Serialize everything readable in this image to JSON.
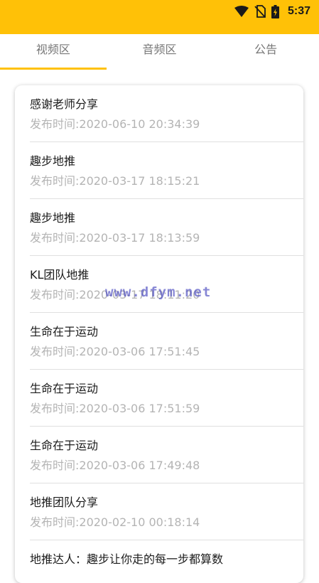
{
  "status_bar": {
    "time": "5:37",
    "background_color": "#ffc107",
    "icons": [
      "wifi-icon",
      "no-sim-icon",
      "battery-charging-icon"
    ]
  },
  "tabs": [
    {
      "label": "视频区",
      "active": true
    },
    {
      "label": "音频区",
      "active": false
    },
    {
      "label": "公告",
      "active": false
    }
  ],
  "accent_color": "#ffc107",
  "announcements": [
    {
      "title": "感谢老师分享",
      "time": "发布时间:2020-06-10 20:34:39"
    },
    {
      "title": "趣步地推",
      "time": "发布时间:2020-03-17 18:15:21"
    },
    {
      "title": "趣步地推",
      "time": "发布时间:2020-03-17 18:13:59"
    },
    {
      "title": "KL团队地推",
      "time": "发布时间:2020-03-17 18:11:20"
    },
    {
      "title": "生命在于运动",
      "time": "发布时间:2020-03-06 17:51:45"
    },
    {
      "title": "生命在于运动",
      "time": "发布时间:2020-03-06 17:51:59"
    },
    {
      "title": "生命在于运动",
      "time": "发布时间:2020-03-06 17:49:48"
    },
    {
      "title": "地推团队分享",
      "time": "发布时间:2020-02-10 00:18:14"
    },
    {
      "title": "地推达人：趣步让你走的每一步都算数",
      "time": ""
    }
  ],
  "watermark": "www.dfym.net"
}
